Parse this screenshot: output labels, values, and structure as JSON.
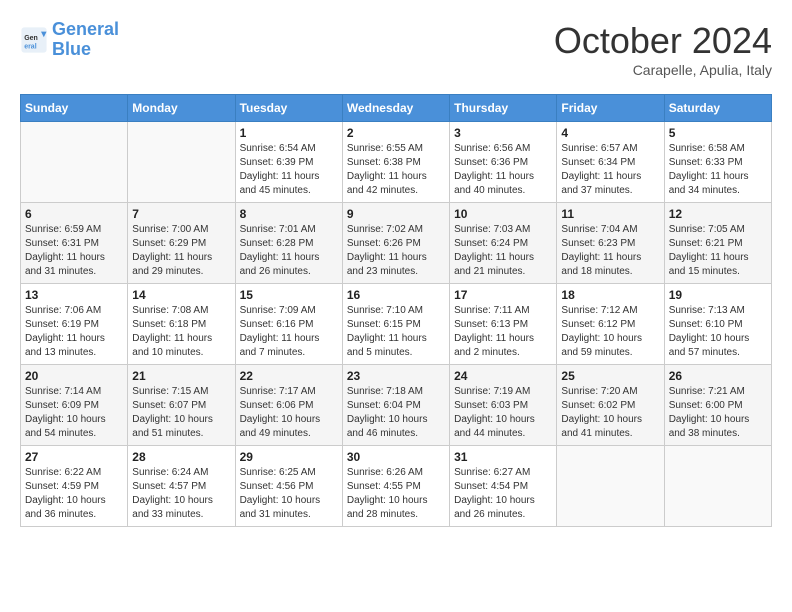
{
  "logo": {
    "line1": "General",
    "line2": "Blue"
  },
  "title": "October 2024",
  "subtitle": "Carapelle, Apulia, Italy",
  "days_of_week": [
    "Sunday",
    "Monday",
    "Tuesday",
    "Wednesday",
    "Thursday",
    "Friday",
    "Saturday"
  ],
  "weeks": [
    [
      {
        "day": "",
        "info": ""
      },
      {
        "day": "",
        "info": ""
      },
      {
        "day": "1",
        "info": "Sunrise: 6:54 AM\nSunset: 6:39 PM\nDaylight: 11 hours and 45 minutes."
      },
      {
        "day": "2",
        "info": "Sunrise: 6:55 AM\nSunset: 6:38 PM\nDaylight: 11 hours and 42 minutes."
      },
      {
        "day": "3",
        "info": "Sunrise: 6:56 AM\nSunset: 6:36 PM\nDaylight: 11 hours and 40 minutes."
      },
      {
        "day": "4",
        "info": "Sunrise: 6:57 AM\nSunset: 6:34 PM\nDaylight: 11 hours and 37 minutes."
      },
      {
        "day": "5",
        "info": "Sunrise: 6:58 AM\nSunset: 6:33 PM\nDaylight: 11 hours and 34 minutes."
      }
    ],
    [
      {
        "day": "6",
        "info": "Sunrise: 6:59 AM\nSunset: 6:31 PM\nDaylight: 11 hours and 31 minutes."
      },
      {
        "day": "7",
        "info": "Sunrise: 7:00 AM\nSunset: 6:29 PM\nDaylight: 11 hours and 29 minutes."
      },
      {
        "day": "8",
        "info": "Sunrise: 7:01 AM\nSunset: 6:28 PM\nDaylight: 11 hours and 26 minutes."
      },
      {
        "day": "9",
        "info": "Sunrise: 7:02 AM\nSunset: 6:26 PM\nDaylight: 11 hours and 23 minutes."
      },
      {
        "day": "10",
        "info": "Sunrise: 7:03 AM\nSunset: 6:24 PM\nDaylight: 11 hours and 21 minutes."
      },
      {
        "day": "11",
        "info": "Sunrise: 7:04 AM\nSunset: 6:23 PM\nDaylight: 11 hours and 18 minutes."
      },
      {
        "day": "12",
        "info": "Sunrise: 7:05 AM\nSunset: 6:21 PM\nDaylight: 11 hours and 15 minutes."
      }
    ],
    [
      {
        "day": "13",
        "info": "Sunrise: 7:06 AM\nSunset: 6:19 PM\nDaylight: 11 hours and 13 minutes."
      },
      {
        "day": "14",
        "info": "Sunrise: 7:08 AM\nSunset: 6:18 PM\nDaylight: 11 hours and 10 minutes."
      },
      {
        "day": "15",
        "info": "Sunrise: 7:09 AM\nSunset: 6:16 PM\nDaylight: 11 hours and 7 minutes."
      },
      {
        "day": "16",
        "info": "Sunrise: 7:10 AM\nSunset: 6:15 PM\nDaylight: 11 hours and 5 minutes."
      },
      {
        "day": "17",
        "info": "Sunrise: 7:11 AM\nSunset: 6:13 PM\nDaylight: 11 hours and 2 minutes."
      },
      {
        "day": "18",
        "info": "Sunrise: 7:12 AM\nSunset: 6:12 PM\nDaylight: 10 hours and 59 minutes."
      },
      {
        "day": "19",
        "info": "Sunrise: 7:13 AM\nSunset: 6:10 PM\nDaylight: 10 hours and 57 minutes."
      }
    ],
    [
      {
        "day": "20",
        "info": "Sunrise: 7:14 AM\nSunset: 6:09 PM\nDaylight: 10 hours and 54 minutes."
      },
      {
        "day": "21",
        "info": "Sunrise: 7:15 AM\nSunset: 6:07 PM\nDaylight: 10 hours and 51 minutes."
      },
      {
        "day": "22",
        "info": "Sunrise: 7:17 AM\nSunset: 6:06 PM\nDaylight: 10 hours and 49 minutes."
      },
      {
        "day": "23",
        "info": "Sunrise: 7:18 AM\nSunset: 6:04 PM\nDaylight: 10 hours and 46 minutes."
      },
      {
        "day": "24",
        "info": "Sunrise: 7:19 AM\nSunset: 6:03 PM\nDaylight: 10 hours and 44 minutes."
      },
      {
        "day": "25",
        "info": "Sunrise: 7:20 AM\nSunset: 6:02 PM\nDaylight: 10 hours and 41 minutes."
      },
      {
        "day": "26",
        "info": "Sunrise: 7:21 AM\nSunset: 6:00 PM\nDaylight: 10 hours and 38 minutes."
      }
    ],
    [
      {
        "day": "27",
        "info": "Sunrise: 6:22 AM\nSunset: 4:59 PM\nDaylight: 10 hours and 36 minutes."
      },
      {
        "day": "28",
        "info": "Sunrise: 6:24 AM\nSunset: 4:57 PM\nDaylight: 10 hours and 33 minutes."
      },
      {
        "day": "29",
        "info": "Sunrise: 6:25 AM\nSunset: 4:56 PM\nDaylight: 10 hours and 31 minutes."
      },
      {
        "day": "30",
        "info": "Sunrise: 6:26 AM\nSunset: 4:55 PM\nDaylight: 10 hours and 28 minutes."
      },
      {
        "day": "31",
        "info": "Sunrise: 6:27 AM\nSunset: 4:54 PM\nDaylight: 10 hours and 26 minutes."
      },
      {
        "day": "",
        "info": ""
      },
      {
        "day": "",
        "info": ""
      }
    ]
  ]
}
